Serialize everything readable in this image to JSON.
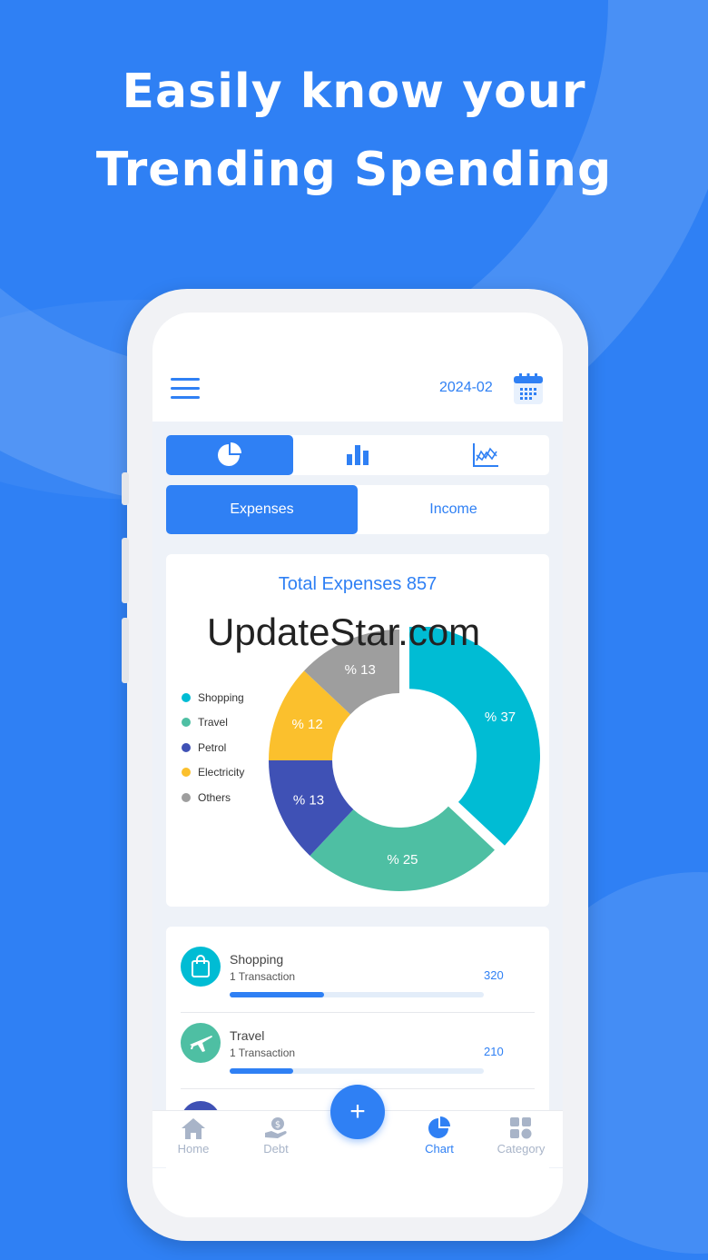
{
  "headline": {
    "line1": "Easily know your",
    "line2": "Trending Spending"
  },
  "header": {
    "date": "2024-02",
    "menu_icon": "hamburger-menu-icon",
    "calendar_icon": "calendar-icon"
  },
  "chart_tabs": [
    {
      "icon": "pie-chart-icon",
      "active": true
    },
    {
      "icon": "bar-chart-icon",
      "active": false
    },
    {
      "icon": "line-chart-icon",
      "active": false
    }
  ],
  "type_tabs": {
    "expenses": "Expenses",
    "income": "Income",
    "active": "Expenses"
  },
  "chart_data": {
    "type": "pie",
    "title": "Total Expenses 857",
    "legend_position": "left",
    "slices": [
      {
        "name": "Shopping",
        "percent": 37,
        "label": "% 37",
        "color": "#00bcd4"
      },
      {
        "name": "Travel",
        "percent": 25,
        "label": "% 25",
        "color": "#4ebfa3"
      },
      {
        "name": "Petrol",
        "percent": 13,
        "label": "% 13",
        "color": "#3f51b5"
      },
      {
        "name": "Electricity",
        "percent": 12,
        "label": "% 12",
        "color": "#fbc02d"
      },
      {
        "name": "Others",
        "percent": 13,
        "label": "% 13",
        "color": "#9e9e9e"
      }
    ]
  },
  "watermark": "UpdateStar.com",
  "list": [
    {
      "name": "Shopping",
      "sub": "1 Transaction",
      "amount": "320",
      "progress": 0.37,
      "icon": "shopping-bag-icon",
      "color": "#00bcd4"
    },
    {
      "name": "Travel",
      "sub": "1 Transaction",
      "amount": "210",
      "progress": 0.25,
      "icon": "airplane-icon",
      "color": "#4ebfa3"
    }
  ],
  "nav": [
    {
      "label": "Home",
      "icon": "home-icon",
      "active": false
    },
    {
      "label": "Debt",
      "icon": "debt-icon",
      "active": false
    },
    {
      "label": "Chart",
      "icon": "pie-chart-icon",
      "active": true
    },
    {
      "label": "Category",
      "icon": "category-grid-icon",
      "active": false
    }
  ],
  "fab_label": "+",
  "colors": {
    "accent": "#2f80f4",
    "background": "#2f80f4"
  }
}
